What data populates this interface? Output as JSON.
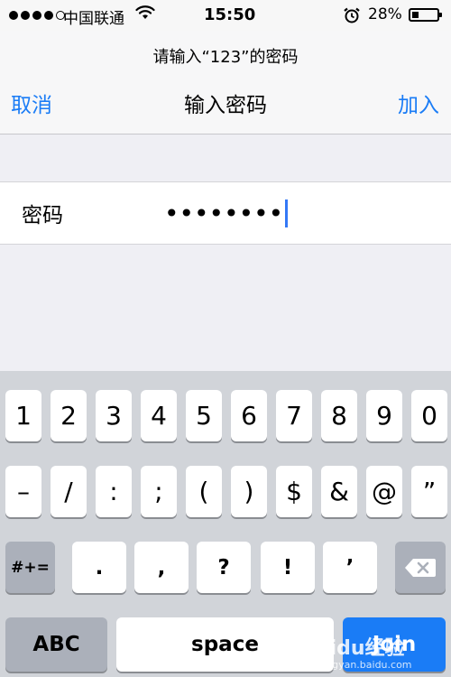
{
  "status_bar": {
    "carrier": "中国联通",
    "time": "15:50",
    "battery_percent": "28%",
    "battery_level": 0.28,
    "signal_bars_filled": 4,
    "signal_bars_total": 5
  },
  "navbar": {
    "prompt": "请输入“123”的密码",
    "cancel_label": "取消",
    "title": "输入密码",
    "join_label": "加入"
  },
  "form": {
    "password_label": "密码",
    "password_value": "••••••••"
  },
  "keyboard": {
    "row1": [
      "1",
      "2",
      "3",
      "4",
      "5",
      "6",
      "7",
      "8",
      "9",
      "0"
    ],
    "row2": [
      "–",
      "/",
      ":",
      ";",
      "(",
      ")",
      "$",
      "&",
      "@",
      "”"
    ],
    "row3_mode_key": "#+=",
    "row3": [
      ".",
      ",",
      "?",
      "!",
      "’"
    ],
    "abc_label": "ABC",
    "space_label": "space",
    "return_label": "Join"
  },
  "watermark": {
    "text": "我爱Baidu经验",
    "sub": "jingyan.baidu.com"
  },
  "colors": {
    "accent": "#1a7cf6",
    "keyboard_bg": "#d1d4d9",
    "dark_key": "#abb0ba"
  }
}
